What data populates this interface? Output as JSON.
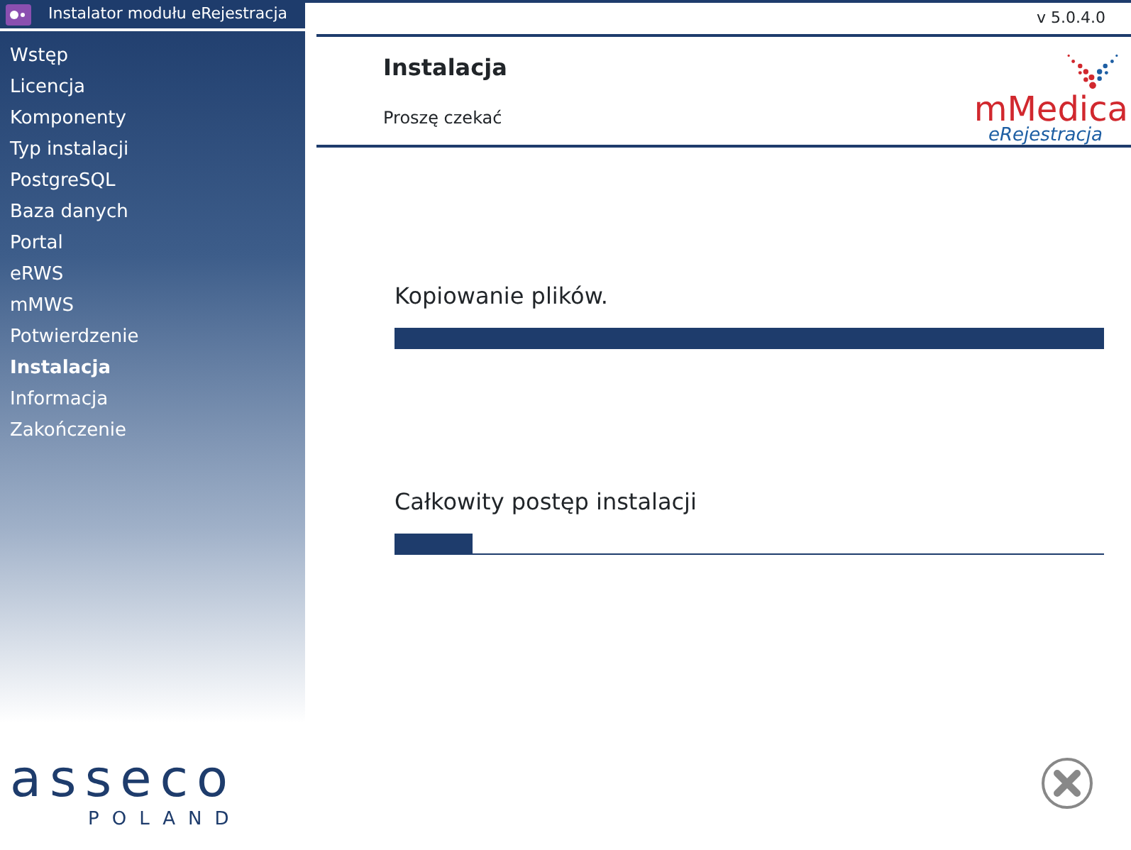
{
  "window": {
    "title": "Instalator modułu eRejestracja"
  },
  "version": "v 5.0.4.0",
  "sidebar": {
    "items": [
      {
        "label": "Wstęp",
        "selected": false
      },
      {
        "label": "Licencja",
        "selected": false
      },
      {
        "label": "Komponenty",
        "selected": false
      },
      {
        "label": "Typ instalacji",
        "selected": false
      },
      {
        "label": "PostgreSQL",
        "selected": false
      },
      {
        "label": "Baza danych",
        "selected": false
      },
      {
        "label": "Portal",
        "selected": false
      },
      {
        "label": "eRWS",
        "selected": false
      },
      {
        "label": "mMWS",
        "selected": false
      },
      {
        "label": "Potwierdzenie",
        "selected": false
      },
      {
        "label": "Instalacja",
        "selected": true
      },
      {
        "label": "Informacja",
        "selected": false
      },
      {
        "label": "Zakończenie",
        "selected": false
      }
    ],
    "logo": {
      "name": "asseco",
      "subtitle": "POLAND"
    }
  },
  "header": {
    "title": "Instalacja",
    "subtitle": "Proszę czekać",
    "logo": {
      "name": "mMedica",
      "product": "eRejestracja"
    }
  },
  "progress": [
    {
      "label": "Kopiowanie plików.",
      "level": 1.0
    },
    {
      "label": "Całkowity postęp instalacji",
      "level": 0.11
    }
  ]
}
